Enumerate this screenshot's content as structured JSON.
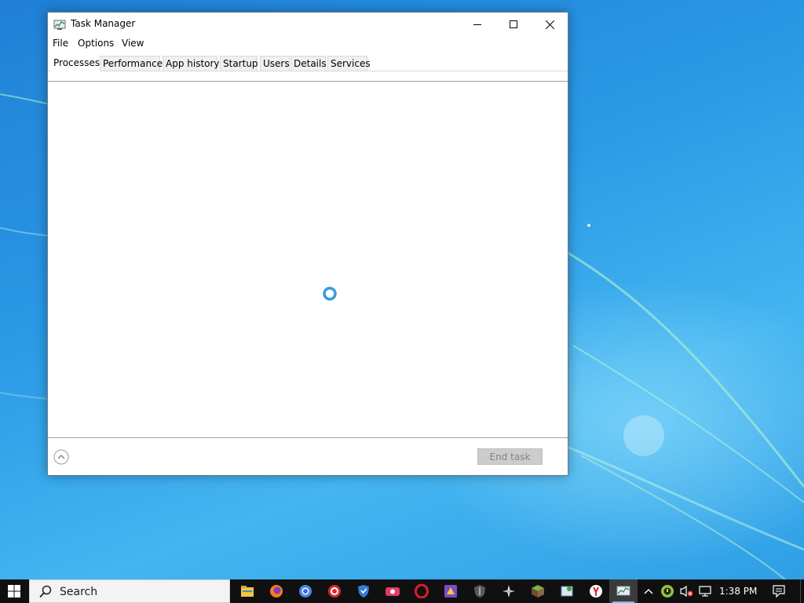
{
  "window": {
    "title": "Task Manager",
    "icon": "task-manager-icon"
  },
  "menu": {
    "file": "File",
    "options": "Options",
    "view": "View"
  },
  "tabs": [
    {
      "label": "Processes",
      "active": true
    },
    {
      "label": "Performance",
      "active": false
    },
    {
      "label": "App history",
      "active": false
    },
    {
      "label": "Startup",
      "active": false
    },
    {
      "label": "Users",
      "active": false
    },
    {
      "label": "Details",
      "active": false
    },
    {
      "label": "Services",
      "active": false
    }
  ],
  "content": {
    "state_icon": "loading-spinner-icon"
  },
  "footer": {
    "fewer_details_icon": "chevron-up-circle-icon",
    "end_task_label": "End task",
    "end_task_enabled": false
  },
  "taskbar": {
    "search_placeholder": "Search",
    "apps": [
      {
        "name": "file-explorer-icon"
      },
      {
        "name": "firefox-icon"
      },
      {
        "name": "chrome-icon"
      },
      {
        "name": "red-app-icon"
      },
      {
        "name": "shield-app-icon"
      },
      {
        "name": "camera-app-icon"
      },
      {
        "name": "opera-icon"
      },
      {
        "name": "game-app-icon"
      },
      {
        "name": "tank-game-icon"
      },
      {
        "name": "compass-app-icon"
      },
      {
        "name": "minecraft-icon"
      },
      {
        "name": "installer-app-icon"
      },
      {
        "name": "yandex-browser-icon"
      },
      {
        "name": "task-manager-taskbar-icon",
        "active": true
      }
    ],
    "clock": "1:38 PM"
  },
  "colors": {
    "accent_blue": "#3c9ad8",
    "taskbar": "#101010",
    "end_task_disabled": "#cccccc"
  }
}
